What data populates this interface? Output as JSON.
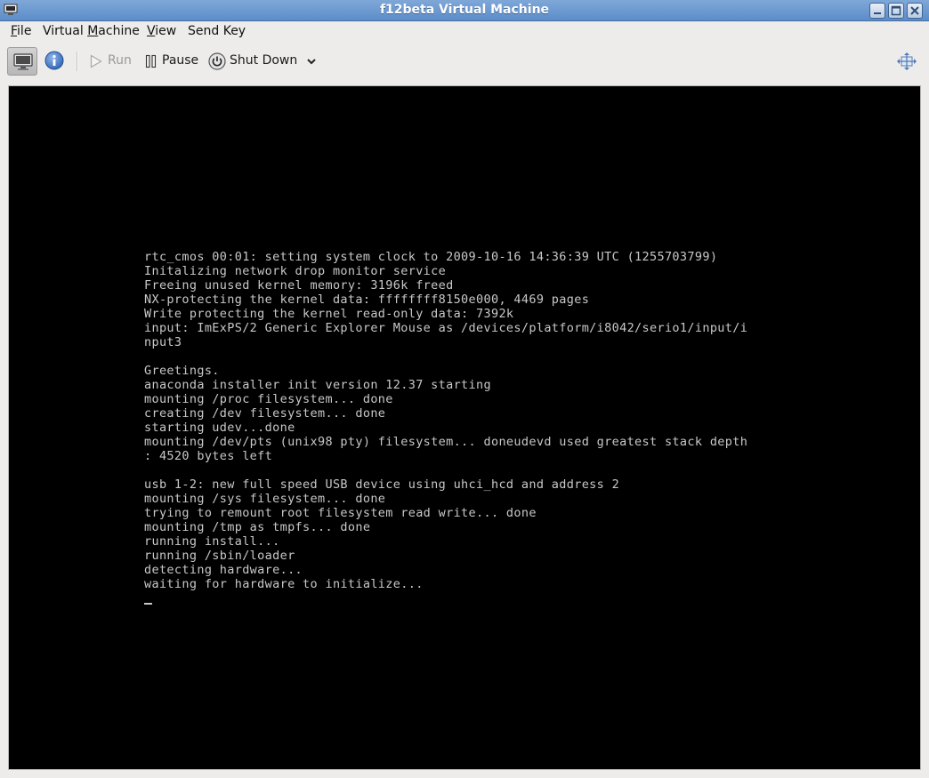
{
  "window": {
    "title": "f12beta Virtual Machine",
    "app_icon": "vm-console-icon",
    "controls": [
      "minimize-icon",
      "maximize-icon",
      "close-icon"
    ]
  },
  "menubar": {
    "items": [
      {
        "label_pre": "",
        "label_mn": "F",
        "label_post": "ile"
      },
      {
        "label_pre": "Virtual ",
        "label_mn": "M",
        "label_post": "achine"
      },
      {
        "label_pre": "",
        "label_mn": "V",
        "label_post": "iew"
      },
      {
        "label_pre": "Send Key",
        "label_mn": "",
        "label_post": ""
      }
    ]
  },
  "toolbar": {
    "console_icon": "monitor-icon",
    "details_icon": "info-icon",
    "run_label": "Run",
    "pause_label": "Pause",
    "shutdown_label": "Shut Down",
    "shutdown_menu_icon": "chevron-down-icon",
    "fullscreen_icon": "fullscreen-icon"
  },
  "console": {
    "lines": [
      "rtc_cmos 00:01: setting system clock to 2009-10-16 14:36:39 UTC (1255703799)",
      "Initalizing network drop monitor service",
      "Freeing unused kernel memory: 3196k freed",
      "NX-protecting the kernel data: ffffffff8150e000, 4469 pages",
      "Write protecting the kernel read-only data: 7392k",
      "input: ImExPS/2 Generic Explorer Mouse as /devices/platform/i8042/serio1/input/i",
      "nput3",
      "",
      "Greetings.",
      "anaconda installer init version 12.37 starting",
      "mounting /proc filesystem... done",
      "creating /dev filesystem... done",
      "starting udev...done",
      "mounting /dev/pts (unix98 pty) filesystem... doneudevd used greatest stack depth",
      ": 4520 bytes left",
      "",
      "usb 1-2: new full speed USB device using uhci_hcd and address 2",
      "mounting /sys filesystem... done",
      "trying to remount root filesystem read write... done",
      "mounting /tmp as tmpfs... done",
      "running install...",
      "running /sbin/loader",
      "detecting hardware...",
      "waiting for hardware to initialize..."
    ],
    "text_color": "#c8c8c8",
    "background": "#000000"
  },
  "colors": {
    "titlebar": "#6a97d0",
    "chrome": "#edeceb"
  }
}
